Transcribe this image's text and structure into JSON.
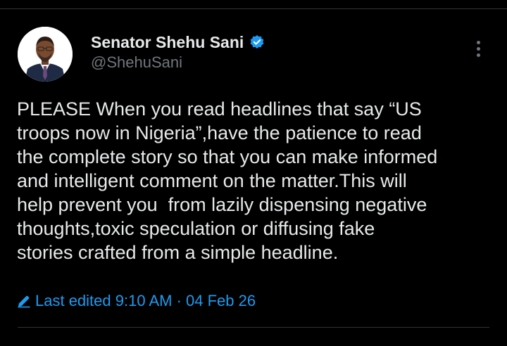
{
  "author": {
    "display_name": "Senator Shehu Sani",
    "handle": "@ShehuSani",
    "verified": true,
    "verified_color": "#1d9bf0"
  },
  "tweet": {
    "lines": [
      "PLEASE When you read headlines that say “US",
      "troops now in Nigeria”,have the patience to read",
      "the complete story so that you can make informed",
      "and intelligent comment on the matter.This will",
      "help prevent you  from lazily dispensing negative",
      "thoughts,toxic speculation or diffusing fake",
      "stories crafted from a simple headline."
    ]
  },
  "edited": {
    "label": "Last edited 9:10 AM · 04 Feb 26",
    "icon": "pencil-icon",
    "color": "#1d9bf0"
  },
  "icons": {
    "verified": "verified-badge-icon",
    "more": "more-vertical-icon",
    "avatar": "profile-photo"
  },
  "colors": {
    "background": "#000000",
    "text": "#e7e9ea",
    "secondary": "#71767b",
    "accent": "#1d9bf0"
  }
}
